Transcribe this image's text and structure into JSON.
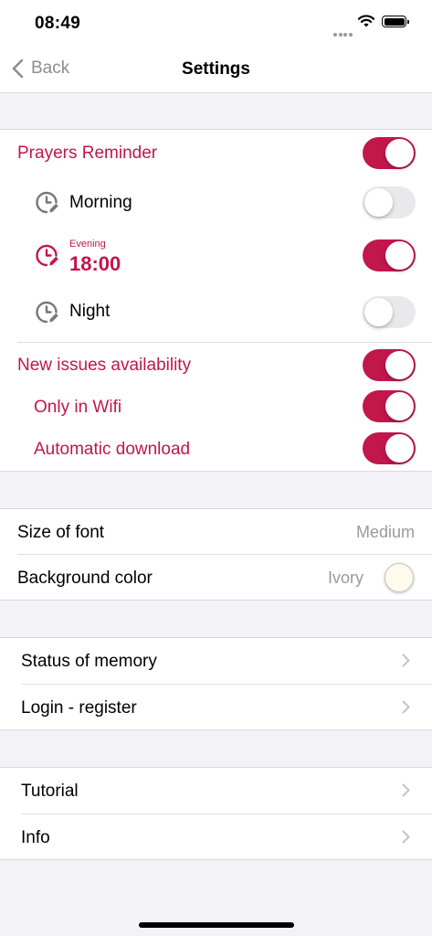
{
  "status": {
    "time": "08:49"
  },
  "nav": {
    "back_label": "Back",
    "title": "Settings"
  },
  "prayers": {
    "label": "Prayers Reminder",
    "enabled": true,
    "morning": {
      "label": "Morning",
      "enabled": false
    },
    "evening": {
      "caption": "Evening",
      "time": "18:00",
      "enabled": true
    },
    "night": {
      "label": "Night",
      "enabled": false
    }
  },
  "issues": {
    "label": "New issues availability",
    "enabled": true,
    "wifi": {
      "label": "Only in Wifi",
      "enabled": true
    },
    "autodownload": {
      "label": "Automatic download",
      "enabled": true
    }
  },
  "display": {
    "font_size": {
      "label": "Size of font",
      "value": "Medium"
    },
    "background": {
      "label": "Background color",
      "value": "Ivory",
      "swatch": "#fffaeb"
    }
  },
  "account": {
    "memory": "Status of memory",
    "login": "Login - register"
  },
  "help": {
    "tutorial": "Tutorial",
    "info": "Info"
  },
  "colors": {
    "accent": "#c1174a",
    "secondary": "#8e8e93"
  },
  "icons": {
    "back": "chevron-left-icon",
    "clock": "clock-edit-icon",
    "disclosure": "chevron-right-icon"
  }
}
